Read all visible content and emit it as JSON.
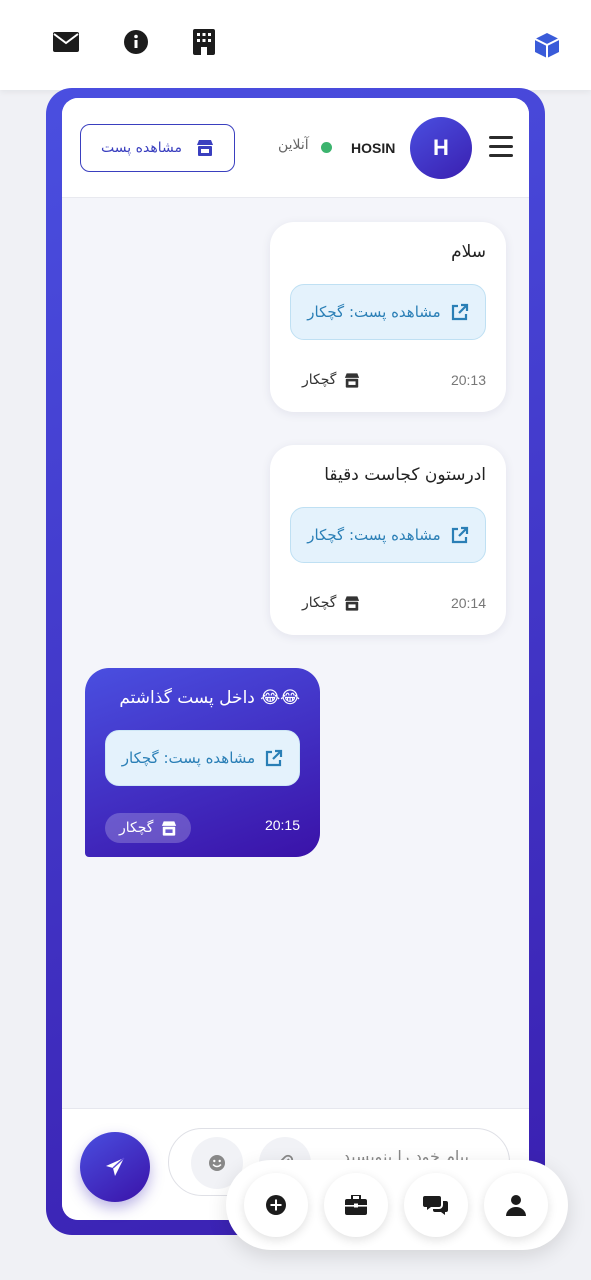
{
  "topbar": {
    "icons": [
      "envelope-icon",
      "info-icon",
      "building-icon",
      "cube-icon"
    ]
  },
  "chat": {
    "user": {
      "avatar_letter": "H",
      "name": "HOSIN",
      "status": "آنلاین"
    },
    "view_post_label": "مشاهده پست",
    "messages": [
      {
        "direction": "in",
        "text": "سلام",
        "link_label": "مشاهده پست: گچکار",
        "time": "20:13",
        "shop": "گچکار"
      },
      {
        "direction": "in",
        "text": "ادرستون کجاست دقیقا",
        "link_label": "مشاهده پست: گچکار",
        "time": "20:14",
        "shop": "گچکار"
      },
      {
        "direction": "out",
        "text": "😂😂 داخل پست گذاشتم",
        "link_label": "مشاهده پست: گچکار",
        "time": "20:15",
        "shop": "گچکار"
      }
    ]
  },
  "composer": {
    "placeholder": "پیام خود را بنویسید..."
  },
  "colors": {
    "accent": "#3a1fb0",
    "accent_light": "#4a4fe0",
    "online": "#3cb46e",
    "link_bg": "#e4f2fc",
    "link_text": "#2a7fb6"
  },
  "bottom_nav": {
    "items": [
      "add-icon",
      "briefcase-icon",
      "chat-icon",
      "user-icon"
    ]
  }
}
